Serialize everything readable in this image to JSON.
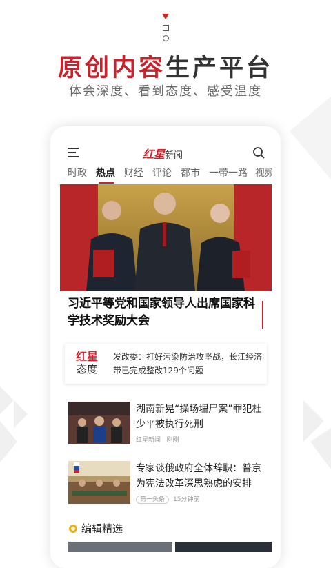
{
  "headline": {
    "part1": "原创内容",
    "part2": "生产平台"
  },
  "subhead": "体会深度、看到态度、感受温度",
  "app": {
    "logo_main": "红星",
    "logo_sub": "新闻",
    "tabs": [
      "时政",
      "热点",
      "财经",
      "评论",
      "都市",
      "一带一路",
      "视频"
    ],
    "active_tab_index": 1
  },
  "lead_story": {
    "title": "习近平等党和国家领导人出席国家科学技术奖励大会",
    "carousel": {
      "count": 4,
      "current": 1
    }
  },
  "attitude": {
    "badge_top": "红星",
    "badge_bottom": "态度",
    "text": "发改委：打好污染防治攻坚战，长江经济带已完成整改129个问题"
  },
  "news": [
    {
      "title": "湖南新晃“操场埋尸案”罪犯杜少平被执行死刑",
      "source": "红星新闻",
      "time": "刚刚"
    },
    {
      "title": "专家谈俄政府全体辞职：普京为宪法改革深思熟虑的安排",
      "source": "第一头条",
      "time": "15分钟前"
    }
  ],
  "section_title": "编辑精选",
  "colors": {
    "accent": "#c8232c",
    "text": "#222222"
  }
}
